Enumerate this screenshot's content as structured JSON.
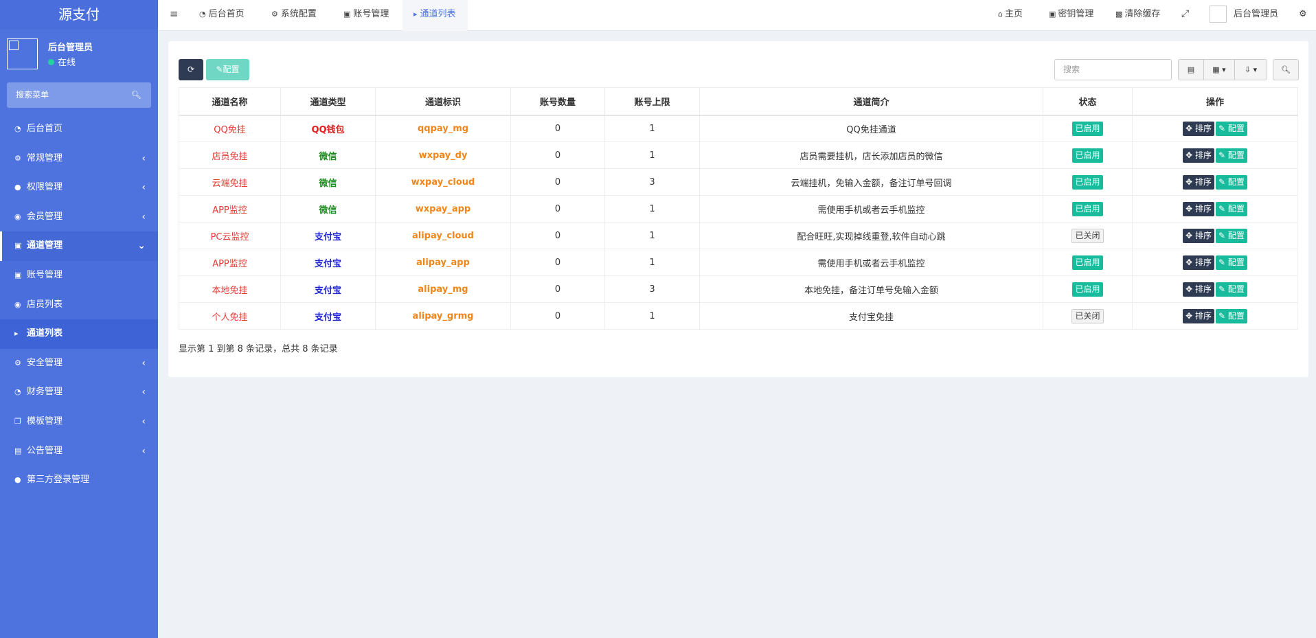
{
  "app": {
    "logo": "源支付"
  },
  "user": {
    "name": "后台管理员",
    "status": "在线"
  },
  "sidebar": {
    "search_placeholder": "搜索菜单",
    "items": [
      {
        "label": "后台首页",
        "icon": "dashboard-icon"
      },
      {
        "label": "常规管理",
        "icon": "cogs-icon"
      },
      {
        "label": "权限管理",
        "icon": "group-icon"
      },
      {
        "label": "会员管理",
        "icon": "user-circle-icon"
      },
      {
        "label": "通道管理",
        "icon": "channel-icon"
      },
      {
        "label": "账号管理",
        "icon": "account-icon"
      },
      {
        "label": "店员列表",
        "icon": "wechat-icon"
      },
      {
        "label": "通道列表",
        "icon": "list-icon"
      },
      {
        "label": "安全管理",
        "icon": "shield-icon"
      },
      {
        "label": "财务管理",
        "icon": "pie-chart-icon"
      },
      {
        "label": "模板管理",
        "icon": "clone-icon"
      },
      {
        "label": "公告管理",
        "icon": "file-icon"
      },
      {
        "label": "第三方登录管理",
        "icon": "users-icon"
      }
    ]
  },
  "topbar": {
    "tabs": [
      "后台首页",
      "系统配置",
      "账号管理",
      "通道列表"
    ],
    "right": {
      "home": "主页",
      "keys": "密钥管理",
      "clear_cache": "清除缓存",
      "admin": "后台管理员"
    }
  },
  "toolbar": {
    "config_label": "配置",
    "search_placeholder": "搜索"
  },
  "table": {
    "headers": [
      "通道名称",
      "通道类型",
      "通道标识",
      "账号数量",
      "账号上限",
      "通道简介",
      "状态",
      "操作"
    ],
    "rows": [
      {
        "name": "QQ免挂",
        "type": "QQ钱包",
        "ident": "qqpay_mg",
        "count": "0",
        "limit": "1",
        "desc": "QQ免挂通道",
        "status": "已启用"
      },
      {
        "name": "店员免挂",
        "type": "微信",
        "ident": "wxpay_dy",
        "count": "0",
        "limit": "1",
        "desc": "店员需要挂机，店长添加店员的微信",
        "status": "已启用"
      },
      {
        "name": "云端免挂",
        "type": "微信",
        "ident": "wxpay_cloud",
        "count": "0",
        "limit": "3",
        "desc": "云端挂机，免输入金额，备注订单号回调",
        "status": "已启用"
      },
      {
        "name": "APP监控",
        "type": "微信",
        "ident": "wxpay_app",
        "count": "0",
        "limit": "1",
        "desc": "需使用手机或者云手机监控",
        "status": "已启用"
      },
      {
        "name": "PC云监控",
        "type": "支付宝",
        "ident": "alipay_cloud",
        "count": "0",
        "limit": "1",
        "desc": "配合旺旺,实现掉线重登,软件自动心跳",
        "status": "已关闭"
      },
      {
        "name": "APP监控",
        "type": "支付宝",
        "ident": "alipay_app",
        "count": "0",
        "limit": "1",
        "desc": "需使用手机或者云手机监控",
        "status": "已启用"
      },
      {
        "name": "本地免挂",
        "type": "支付宝",
        "ident": "alipay_mg",
        "count": "0",
        "limit": "3",
        "desc": "本地免挂，备注订单号免输入金额",
        "status": "已启用"
      },
      {
        "name": "个人免挂",
        "type": "支付宝",
        "ident": "alipay_grmg",
        "count": "0",
        "limit": "1",
        "desc": "支付宝免挂",
        "status": "已关闭"
      }
    ],
    "action_sort": "排序",
    "action_config": "配置"
  },
  "summary": "显示第 1 到第 8 条记录，总共 8 条记录",
  "colors": {
    "sidebar": "#4e73df",
    "success": "#18bc9c",
    "dark": "#2f3b52",
    "accent": "#4e73df"
  }
}
